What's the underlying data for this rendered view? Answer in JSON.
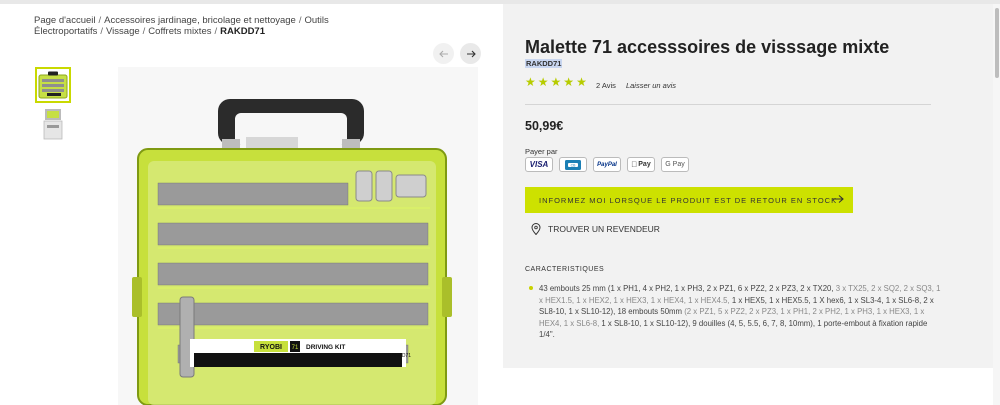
{
  "breadcrumb": {
    "items": [
      "Page d'accueil",
      "Accessoires jardinage, bricolage et nettoyage",
      "Outils Électroportatifs",
      "Vissage",
      "Coffrets mixtes"
    ],
    "current": "RAKDD71",
    "separator": "/"
  },
  "gallery": {
    "prev_icon": "arrow-left-icon",
    "next_icon": "arrow-right-icon",
    "kit_label": "DRIVING KIT",
    "brand_label": "RYOBI",
    "kit_number": "71",
    "kit_sku_label": "RAKDD71"
  },
  "product": {
    "title": "Malette 71 accesssoires de visssage mixte",
    "sku": "RAKDD71",
    "rating": 5,
    "stars": "★★★★★",
    "reviews_count": "2 Avis",
    "leave_review": "Laisser un avis",
    "price": "50,99€",
    "pay_label": "Payer par",
    "pay_methods": [
      "VISA",
      "CB",
      "PayPal",
      "Pay",
      "G Pay"
    ],
    "notify_button": "INFORMEZ MOI LORSQUE LE PRODUIT EST DE RETOUR EN STOCK",
    "dealer_link": "TROUVER UN REVENDEUR"
  },
  "characteristics": {
    "title": "CARACTERISTIQUES",
    "text_a": "43 embouts 25 mm (1 x PH1, 4 x PH2, 1 x PH3, 2 x PZ1, 6 x PZ2, 2 x PZ3, 2 x TX20, ",
    "text_b": "3 x TX25, 2 x SQ2, 2 x SQ3, 1 x HEX1.5, 1 x HEX2, 1 x HEX3, 1 x HEX4, 1 x HEX4.5, ",
    "text_c": "1 x HEX5, 1 x HEX5.5, 1 X hex6, 1 x SL3-4, 1 x SL6-8, 2 x SL8-10, 1 x SL10-12), 18 embouts 50mm ",
    "text_d": "(2 x PZ1, 5 x PZ2, 2 x PZ3, 1 x PH1, 2 x PH2, 1 x PH3, 1 x HEX3, 1 x HEX4, 1 x SL6-8, ",
    "text_e": "1 x SL8-10, 1 x SL10-12), 9 douilles (4, 5, 5.5, 6, 7, 8, 10mm), 1 porte-embout à fixation rapide 1/4\"."
  },
  "colors": {
    "accent": "#cde100",
    "star": "#b7cc00",
    "panel": "#f2f2f2"
  }
}
